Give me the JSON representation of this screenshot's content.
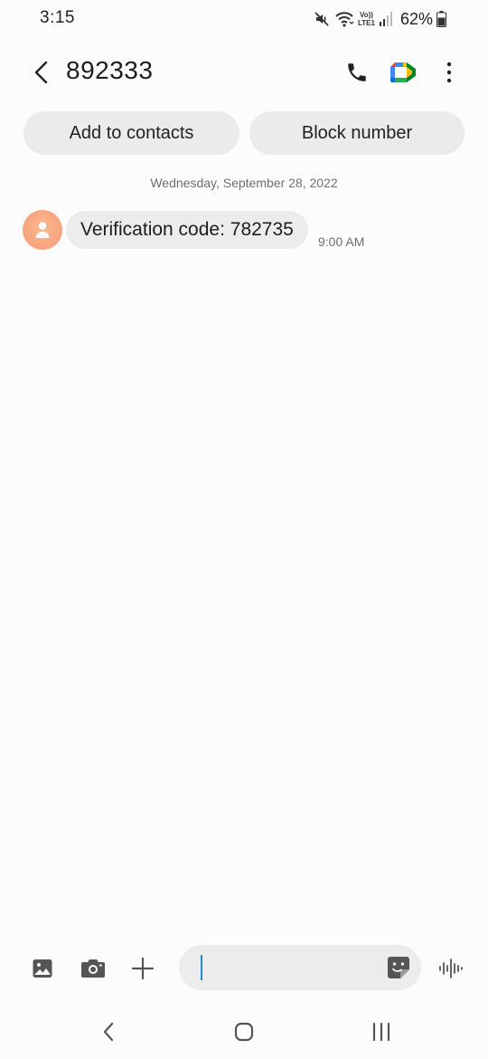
{
  "status_bar": {
    "time": "3:15",
    "battery": "62%",
    "network_label_top": "Vo))",
    "network_label_bottom": "LTE1",
    "icons": [
      "mute-icon",
      "wifi-icon",
      "volte-icon",
      "signal-icon",
      "battery-icon"
    ]
  },
  "header": {
    "title": "892333",
    "icons": [
      "back-icon",
      "phone-icon",
      "video-call-icon",
      "more-options-icon"
    ]
  },
  "actions": {
    "add_contacts": "Add to contacts",
    "block_number": "Block number"
  },
  "conversation": {
    "date": "Wednesday, September 28, 2022",
    "messages": [
      {
        "text": "Verification code: 782735",
        "time": "9:00 AM"
      }
    ]
  },
  "composer": {
    "value": "",
    "placeholder": "",
    "icons": [
      "gallery-icon",
      "camera-icon",
      "add-icon",
      "sticker-icon",
      "voice-recorder-icon"
    ]
  },
  "nav_bar": {
    "icons": [
      "recent-apps-icon",
      "home-icon",
      "back-nav-icon"
    ]
  },
  "colors": {
    "background": "#fcfcfc",
    "bubble": "#ececec",
    "avatar": "#f7a07a",
    "cursor": "#1a8fd6"
  }
}
